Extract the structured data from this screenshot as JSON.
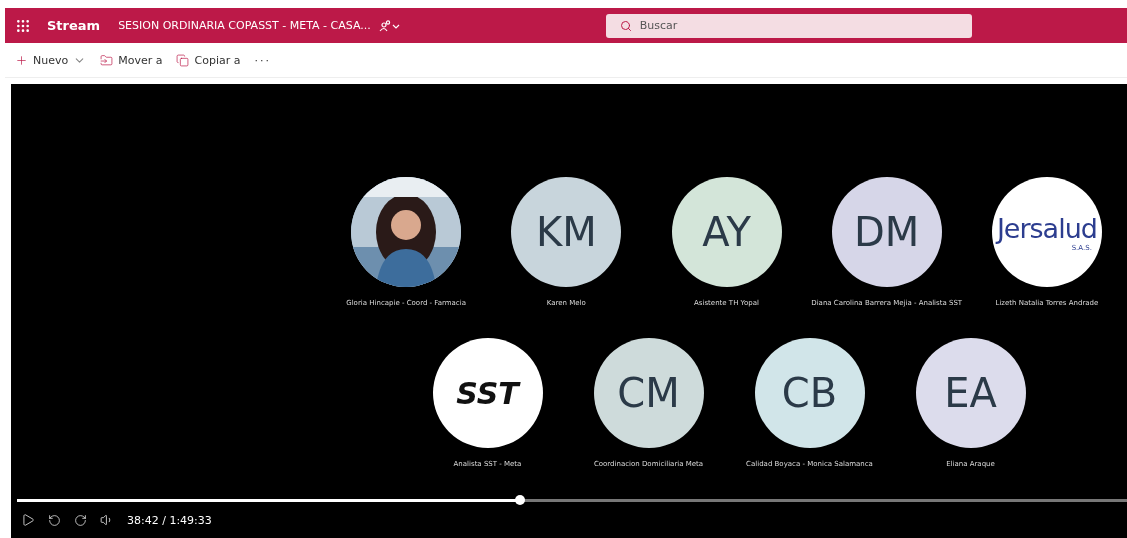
{
  "header": {
    "app": "Stream",
    "title": "SESION ORDINARIA COPASST - META - CASA...",
    "search": {
      "placeholder": "Buscar"
    }
  },
  "toolbar": [
    {
      "kind": "new",
      "label": "Nuevo"
    },
    {
      "kind": "move",
      "label": "Mover a"
    },
    {
      "kind": "copy",
      "label": "Copiar a"
    },
    {
      "kind": "more",
      "label": "···"
    }
  ],
  "video": {
    "rows": [
      [
        {
          "name": "Gloria Hincapie - Coord - Farmacia"
        },
        {
          "kind": "initials",
          "initials": "KM",
          "color": "#c8d5dc",
          "name": "Karen Melo"
        },
        {
          "kind": "initials",
          "initials": "AY",
          "color": "#d3e5d9",
          "name": "Asistente TH Yopal"
        },
        {
          "kind": "initials",
          "initials": "DM",
          "color": "#d6d6e8",
          "name": "Diana Carolina Barrera Mejia - Analista SST"
        },
        {
          "kind": "logo",
          "logo": "Jersalud",
          "sublogo": "S.A.S.",
          "name": "Lizeth Natalia Torres Andrade"
        }
      ],
      [
        {
          "kind": "badge",
          "logo": "SST",
          "name": "Analista SST - Meta"
        },
        {
          "kind": "initials",
          "initials": "CM",
          "color": "#cedbdb",
          "name": "Coordinacion Domiciliaria Meta"
        },
        {
          "kind": "initials",
          "initials": "CB",
          "color": "#d1e5e9",
          "name": "Calidad Boyaca - Monica Salamanca"
        },
        {
          "kind": "initials",
          "initials": "EA",
          "color": "#dcdcec",
          "name": "Eliana Araque"
        }
      ]
    ],
    "progress": {
      "level": 0.453
    },
    "time": "38:42 / 1:49:33"
  }
}
